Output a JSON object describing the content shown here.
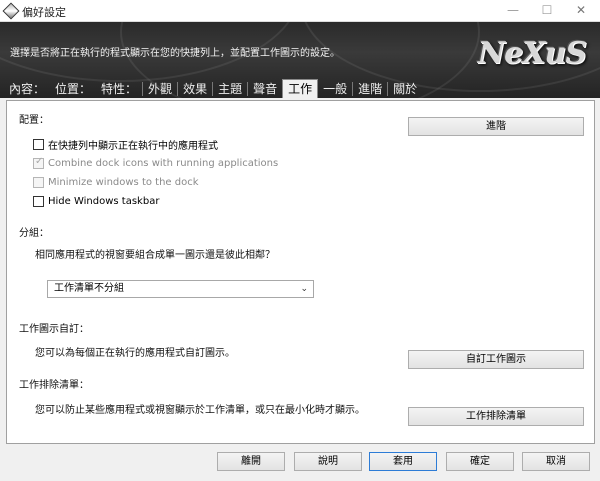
{
  "window": {
    "title": "偏好設定",
    "min_glyph": "—",
    "max_glyph": "☐",
    "close_glyph": "✕",
    "app_icon": "nexus-diamond-icon"
  },
  "header": {
    "description": "選擇是否將正在執行的程式顯示在您的快捷列上，並配置工作圖示的設定。",
    "logo": "NeXuS"
  },
  "tabs": [
    {
      "label": "內容："
    },
    {
      "label": "位置："
    },
    {
      "label": "特性："
    },
    {
      "label": "外觀"
    },
    {
      "label": "效果"
    },
    {
      "label": "主題"
    },
    {
      "label": "聲音"
    },
    {
      "label": "工作"
    },
    {
      "label": "一般"
    },
    {
      "label": "進階"
    },
    {
      "label": "關於"
    }
  ],
  "active_tab": "工作",
  "config": {
    "label": "配置：",
    "advanced_button": "進階",
    "checkboxes": [
      {
        "label": "在快捷列中顯示正在執行中的應用程式",
        "checked": false,
        "enabled": true
      },
      {
        "label": "Combine dock icons with running applications",
        "checked": true,
        "enabled": false
      },
      {
        "label": "Minimize windows to the dock",
        "checked": false,
        "enabled": false
      },
      {
        "label": "Hide Windows taskbar",
        "checked": false,
        "enabled": true
      }
    ]
  },
  "grouping": {
    "label": "分組：",
    "question": "相同應用程式的視窗要組合成單一圖示還是彼此相鄰？",
    "selected": "工作清單不分組"
  },
  "custom_icons": {
    "label": "工作圖示自訂：",
    "description": "您可以為每個正在執行的應用程式自訂圖示。",
    "button": "自訂工作圖示"
  },
  "exclusions": {
    "label": "工作排除清單：",
    "description": "您可以防止某些應用程式或視窗顯示於工作清單，或只在最小化時才顯示。",
    "button": "工作排除清單"
  },
  "footer": {
    "leave": "離開",
    "help": "說明",
    "apply": "套用",
    "ok": "確定",
    "cancel": "取消"
  },
  "colors": {
    "header_bg": "#2f2f2f",
    "default_button_border": "#2d7cd6"
  }
}
